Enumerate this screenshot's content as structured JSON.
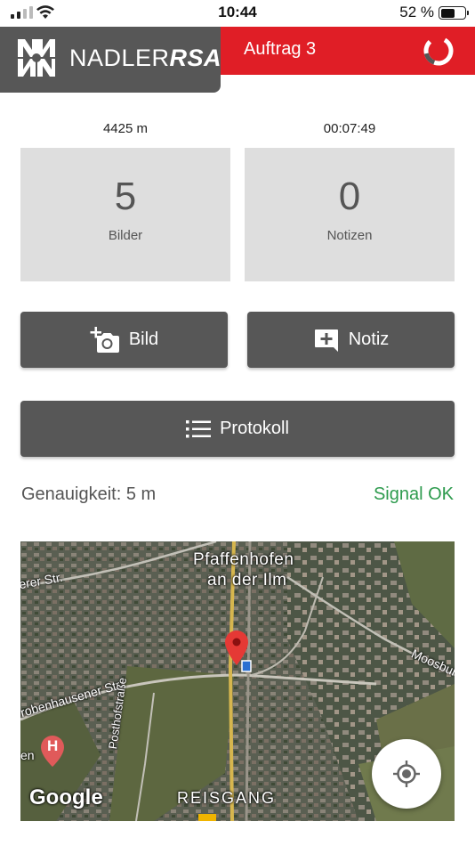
{
  "status_bar": {
    "time": "10:44",
    "battery": "52 %"
  },
  "header": {
    "brand_plain": "NADLER",
    "brand_bold": "RSA",
    "job_title": "Auftrag 3"
  },
  "stats": {
    "distance": "4425 m",
    "duration": "00:07:49",
    "images": {
      "count": "5",
      "label": "Bilder"
    },
    "notes": {
      "count": "0",
      "label": "Notizen"
    }
  },
  "actions": {
    "image_button": "Bild",
    "note_button": "Notiz",
    "protocol_button": "Protokoll"
  },
  "gps": {
    "accuracy": "Genauigkeit: 5 m",
    "signal": "Signal OK"
  },
  "map": {
    "town": "Pfaffenhofen",
    "town_line2": "an der Ilm",
    "street_1": "erer Str.",
    "street_2": "robenhausener Str.",
    "street_3": "Posthofstraße",
    "street_4": "Moosbur",
    "district": "REISGANG",
    "hospital_marker": "H",
    "attribution": "Google",
    "small_left": "en"
  },
  "colors": {
    "brand_red": "#e01e26",
    "dark_gray": "#575757",
    "tile_gray": "#dedede",
    "signal_green": "#2e9b4e"
  }
}
